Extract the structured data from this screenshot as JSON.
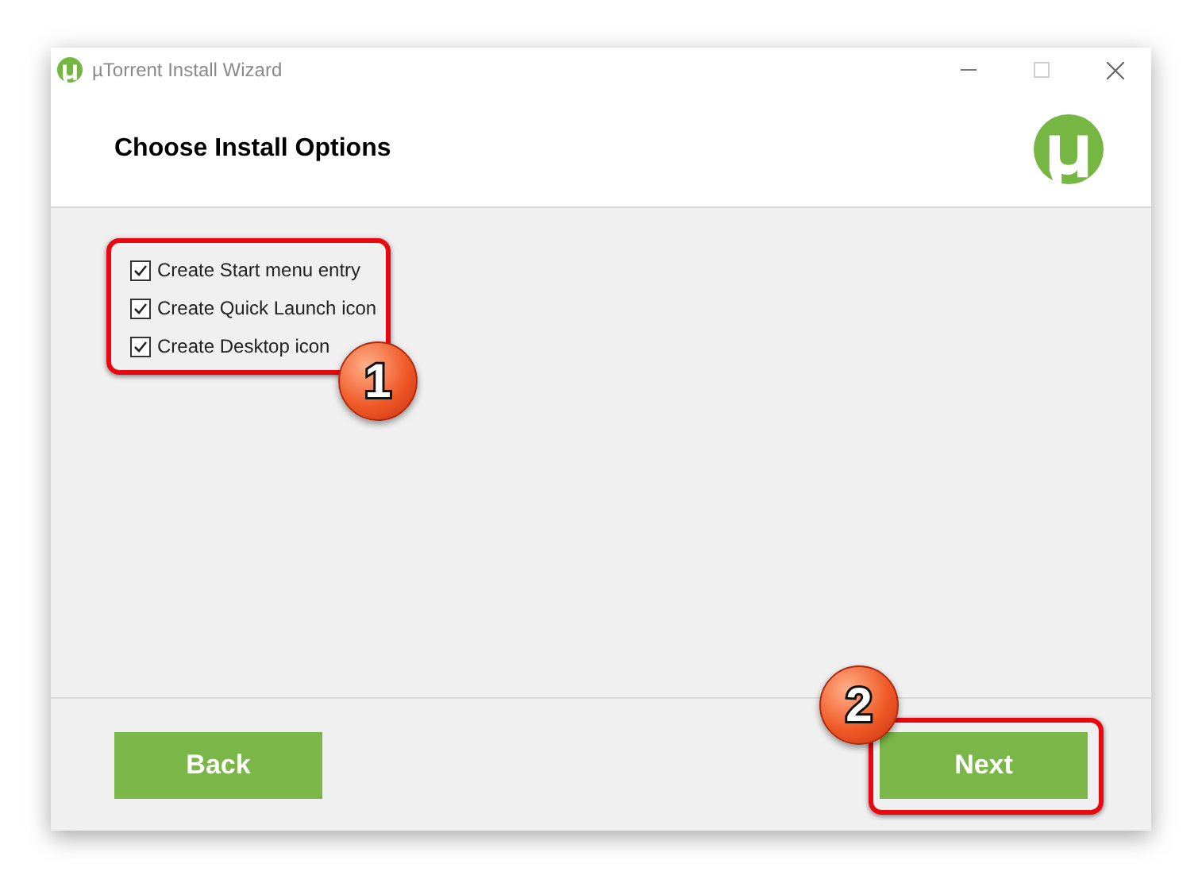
{
  "window": {
    "title": "µTorrent Install Wizard",
    "maximize_disabled": true
  },
  "header": {
    "title": "Choose Install Options"
  },
  "options": [
    {
      "label": "Create Start menu entry",
      "checked": true
    },
    {
      "label": "Create Quick Launch icon",
      "checked": true
    },
    {
      "label": "Create Desktop icon",
      "checked": true
    }
  ],
  "buttons": [
    {
      "label": "Back"
    },
    {
      "label": "Next"
    }
  ],
  "annotations": [
    {
      "number": "1"
    },
    {
      "number": "2"
    }
  ]
}
